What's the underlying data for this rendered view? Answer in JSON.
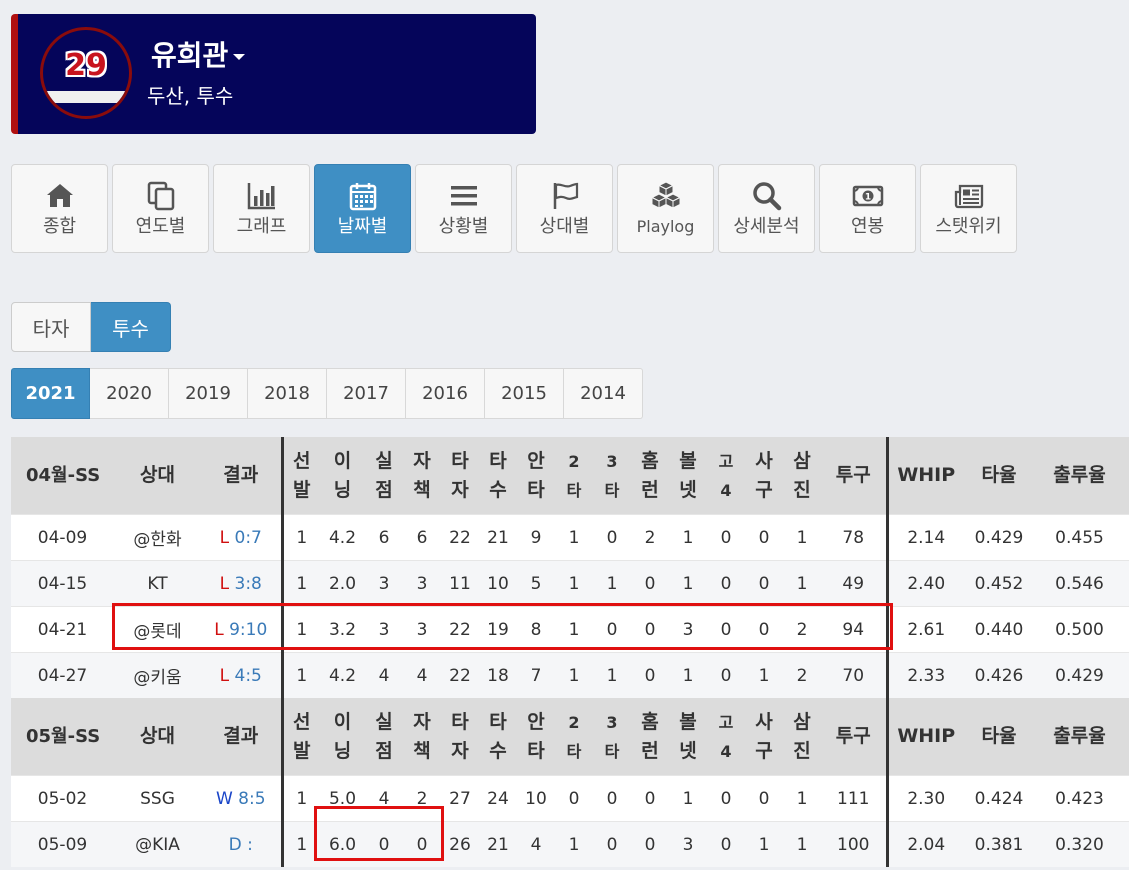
{
  "player": {
    "number": "29",
    "name": "유희관",
    "team_position": "두산, 투수"
  },
  "nav": {
    "tabs": [
      {
        "label": "종합",
        "icon": "home-icon"
      },
      {
        "label": "연도별",
        "icon": "copy-icon"
      },
      {
        "label": "그래프",
        "icon": "bar-chart-icon"
      },
      {
        "label": "날짜별",
        "icon": "calendar-icon",
        "active": true
      },
      {
        "label": "상황별",
        "icon": "list-icon"
      },
      {
        "label": "상대별",
        "icon": "flag-icon"
      },
      {
        "label": "Playlog",
        "icon": "cubes-icon"
      },
      {
        "label": "상세분석",
        "icon": "search-icon"
      },
      {
        "label": "연봉",
        "icon": "money-icon"
      },
      {
        "label": "스탯위키",
        "icon": "newspaper-icon"
      }
    ]
  },
  "role_toggle": {
    "batter": "타자",
    "pitcher": "투수",
    "active": "pitcher"
  },
  "years": [
    "2021",
    "2020",
    "2019",
    "2018",
    "2017",
    "2016",
    "2015",
    "2014"
  ],
  "active_year": "2021",
  "table": {
    "columns": [
      "상대",
      "결과",
      "선\n발",
      "이\n닝",
      "실\n점",
      "자\n책",
      "타\n자",
      "타\n수",
      "안\n타",
      "2\n타",
      "3\n타",
      "홈\n런",
      "볼\n넷",
      "고\n4",
      "사\n구",
      "삼\n진",
      "투구",
      "WHIP",
      "타율",
      "출루율"
    ],
    "sections": [
      {
        "label": "04월-SS",
        "rows": [
          {
            "date": "04-09",
            "opp": "@한화",
            "res": "L",
            "score": "0:7",
            "cells": [
              "1",
              "4.2",
              "6",
              "6",
              "22",
              "21",
              "9",
              "1",
              "0",
              "2",
              "1",
              "0",
              "0",
              "1",
              "78",
              "2.14",
              "0.429",
              "0.455"
            ]
          },
          {
            "date": "04-15",
            "opp": "KT",
            "res": "L",
            "score": "3:8",
            "cells": [
              "1",
              "2.0",
              "3",
              "3",
              "11",
              "10",
              "5",
              "1",
              "1",
              "0",
              "1",
              "0",
              "0",
              "1",
              "49",
              "2.40",
              "0.452",
              "0.546"
            ]
          },
          {
            "date": "04-21",
            "opp": "@롯데",
            "res": "L",
            "score": "9:10",
            "cells": [
              "1",
              "3.2",
              "3",
              "3",
              "22",
              "19",
              "8",
              "1",
              "0",
              "0",
              "3",
              "0",
              "0",
              "2",
              "94",
              "2.61",
              "0.440",
              "0.500"
            ]
          },
          {
            "date": "04-27",
            "opp": "@키움",
            "res": "L",
            "score": "4:5",
            "cells": [
              "1",
              "4.2",
              "4",
              "4",
              "22",
              "18",
              "7",
              "1",
              "1",
              "0",
              "1",
              "0",
              "1",
              "2",
              "70",
              "2.33",
              "0.426",
              "0.429"
            ]
          }
        ]
      },
      {
        "label": "05월-SS",
        "rows": [
          {
            "date": "05-02",
            "opp": "SSG",
            "res": "W",
            "score": "8:5",
            "cells": [
              "1",
              "5.0",
              "4",
              "2",
              "27",
              "24",
              "10",
              "0",
              "0",
              "0",
              "1",
              "0",
              "0",
              "1",
              "111",
              "2.30",
              "0.424",
              "0.423"
            ]
          },
          {
            "date": "05-09",
            "opp": "@KIA",
            "res": "D",
            "score": ":",
            "cells": [
              "1",
              "6.0",
              "0",
              "0",
              "26",
              "21",
              "4",
              "1",
              "0",
              "0",
              "3",
              "0",
              "1",
              "1",
              "100",
              "2.04",
              "0.381",
              "0.320"
            ]
          }
        ]
      }
    ]
  },
  "colors": {
    "header_bg": "#05055a",
    "accent_red": "#b01010",
    "active_blue": "#3f8fc4",
    "loss": "#d01010",
    "win": "#1a45c8",
    "highlight": "#e01010"
  }
}
